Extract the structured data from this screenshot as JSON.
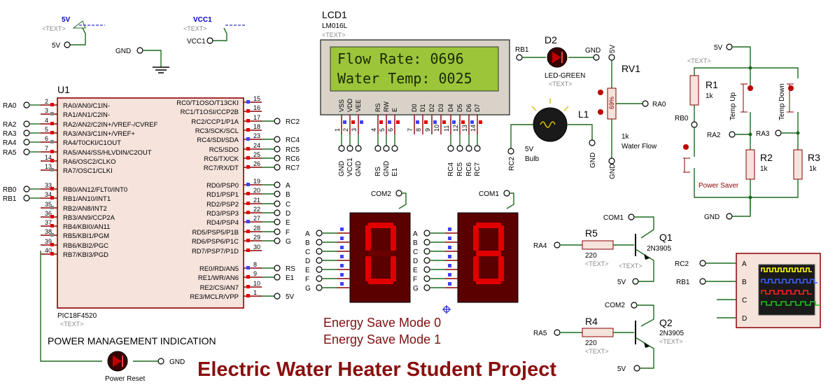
{
  "title": "Electric Water Heater Student Project",
  "lcd": {
    "name": "LCD1",
    "model": "LM016L",
    "text_tag": "<TEXT>",
    "line1": "Flow Rate: 0696",
    "line2": "Water Temp: 0025",
    "pins": [
      "VSS",
      "VDD",
      "VEE",
      "RS",
      "RW",
      "E",
      "D0",
      "D1",
      "D2",
      "D3",
      "D4",
      "D5",
      "D6",
      "D7"
    ],
    "pin_nums": [
      "1",
      "2",
      "3",
      "4",
      "5",
      "6",
      "7",
      "8",
      "9",
      "10",
      "11",
      "12",
      "13",
      "14"
    ],
    "net_labels": [
      "GND",
      "VCC1",
      "GND",
      "RS",
      "GND",
      "E1",
      "RC4",
      "RC5",
      "RC6",
      "RC7"
    ]
  },
  "power": {
    "v5_label": "5V",
    "vcc1_label": "VCC1",
    "text_tag": "<TEXT>",
    "gnd_label": "GND",
    "v5_term": "5V",
    "vcc1_term": "VCC1"
  },
  "mcu": {
    "name": "U1",
    "model": "PIC18F4520",
    "text_tag": "<TEXT>",
    "left_pins": [
      {
        "num": "2",
        "name": "RA0/AN0/C1IN-",
        "net": "RA0"
      },
      {
        "num": "3",
        "name": "RA1/AN1/C2IN-",
        "net": ""
      },
      {
        "num": "4",
        "name": "RA2/AN2/C2IN+/VREF-/CVREF",
        "net": "RA2"
      },
      {
        "num": "5",
        "name": "RA3/AN3/C1IN+/VREF+",
        "net": "RA3"
      },
      {
        "num": "6",
        "name": "RA4/T0CKI/C1OUT",
        "net": "RA4"
      },
      {
        "num": "7",
        "name": "RA5/AN4/SS/HLVDIN/C2OUT",
        "net": "RA5"
      },
      {
        "num": "14",
        "name": "RA6/OSC2/CLKO",
        "net": ""
      },
      {
        "num": "13",
        "name": "RA7/OSC1/CLKI",
        "net": ""
      },
      {
        "num": "33",
        "name": "RB0/AN12/FLT0/INT0",
        "net": "RB0"
      },
      {
        "num": "34",
        "name": "RB1/AN10/INT1",
        "net": "RB1"
      },
      {
        "num": "35",
        "name": "RB2/AN8/INT2",
        "net": ""
      },
      {
        "num": "36",
        "name": "RB3/AN9/CCP2A",
        "net": ""
      },
      {
        "num": "37",
        "name": "RB4/KBI0/AN11",
        "net": ""
      },
      {
        "num": "38",
        "name": "RB5/KBI1/PGM",
        "net": ""
      },
      {
        "num": "39",
        "name": "RB6/KBI2/PGC",
        "net": ""
      },
      {
        "num": "40",
        "name": "RB7/KBI3/PGD",
        "net": ""
      }
    ],
    "right_pins": [
      {
        "num": "15",
        "name": "RC0/T1OSO/T13CKI",
        "net": ""
      },
      {
        "num": "16",
        "name": "RC1/T1OSI/CCP2B",
        "net": ""
      },
      {
        "num": "17",
        "name": "RC2/CCP1/P1A",
        "net": "RC2"
      },
      {
        "num": "18",
        "name": "RC3/SCK/SCL",
        "net": ""
      },
      {
        "num": "23",
        "name": "RC4/SDI/SDA",
        "net": "RC4"
      },
      {
        "num": "24",
        "name": "RC5/SDO",
        "net": "RC5"
      },
      {
        "num": "25",
        "name": "RC6/TX/CK",
        "net": "RC6"
      },
      {
        "num": "26",
        "name": "RC7/RX/DT",
        "net": "RC7"
      },
      {
        "num": "19",
        "name": "RD0/PSP0",
        "net": "A"
      },
      {
        "num": "20",
        "name": "RD1/PSP1",
        "net": "B"
      },
      {
        "num": "21",
        "name": "RD2/PSP2",
        "net": "C"
      },
      {
        "num": "22",
        "name": "RD3/PSP3",
        "net": "D"
      },
      {
        "num": "27",
        "name": "RD4/PSP4",
        "net": "E"
      },
      {
        "num": "28",
        "name": "RD5/PSP5/P1B",
        "net": "F"
      },
      {
        "num": "29",
        "name": "RD6/PSP6/P1C",
        "net": "G"
      },
      {
        "num": "30",
        "name": "RD7/PSP7/P1D",
        "net": ""
      },
      {
        "num": "8",
        "name": "RE0/RD/AN5",
        "net": "RS"
      },
      {
        "num": "9",
        "name": "RE1/WR/AN6",
        "net": "E1"
      },
      {
        "num": "10",
        "name": "RE2/CS/AN7",
        "net": ""
      },
      {
        "num": "1",
        "name": "RE3/MCLR/VPP",
        "net": "5V"
      }
    ]
  },
  "power_led": {
    "caption": "POWER MANAGEMENT INDICATION",
    "label": "Power Reset",
    "gnd": "GND"
  },
  "led_d2": {
    "name": "D2",
    "model": "LED-GREEN",
    "text_tag": "<TEXT>",
    "in_net": "RB1",
    "gnd": "GND"
  },
  "pot": {
    "name": "RV1",
    "value": "1k",
    "desc": "Water Flow",
    "top": "5V",
    "out_net": "RA0",
    "bottom": "GND",
    "pct": "69%"
  },
  "bulb": {
    "name": "L1",
    "value": "5V",
    "desc": "Bulb",
    "net": "RC2",
    "gnd": "GND"
  },
  "sensor": {
    "r1_name": "R1",
    "r1_val": "1k",
    "r2_name": "R2",
    "r2_val": "1k",
    "r3_name": "R3",
    "r3_val": "1k",
    "v5": "5V",
    "text_tag": "<TEXT>",
    "rb0": "RB0",
    "ra2": "RA2",
    "ra3": "RA3",
    "gnd": "GND",
    "temp_up": "Temp Up",
    "temp_down": "Temp Down",
    "power_saver": "Power Saver"
  },
  "seven_seg": {
    "com2": "COM2",
    "com1": "COM1",
    "segments": [
      "A",
      "B",
      "C",
      "D",
      "E",
      "F",
      "G"
    ],
    "digit1": "0",
    "digit2": "8"
  },
  "energy": {
    "mode0": "Energy Save Mode 0",
    "mode1": "Energy Save Mode 1"
  },
  "q1": {
    "name": "Q1",
    "model": "2N3905",
    "text_tag": "<TEXT>",
    "r_name": "R5",
    "r_val": "220",
    "in": "RA4",
    "com": "COM1",
    "v5": "5V"
  },
  "q2": {
    "name": "Q2",
    "model": "2N3905",
    "text_tag": "<TEXT>",
    "r_name": "R4",
    "r_val": "220",
    "in": "RA5",
    "com": "COM2",
    "v5": "5V"
  },
  "scope": {
    "channels": [
      "A",
      "B",
      "C",
      "D"
    ],
    "in_a": "RC2",
    "in_b": "RB1",
    "colors": [
      "#ffff00",
      "#4060ff",
      "#ff2020",
      "#20c020"
    ]
  }
}
